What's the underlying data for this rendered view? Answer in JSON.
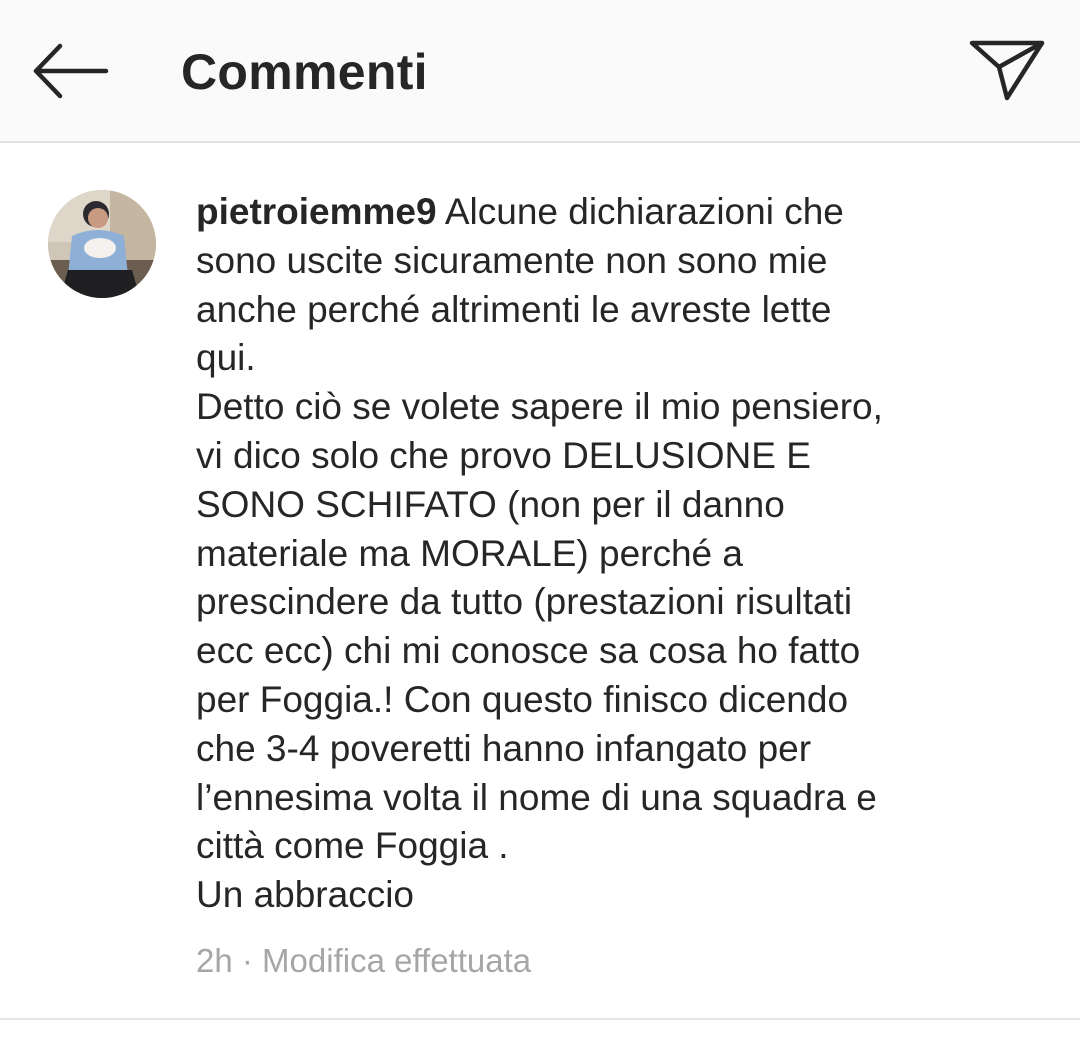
{
  "header": {
    "title": "Commenti",
    "back_icon": "arrow-left-icon",
    "share_icon": "paper-plane-icon"
  },
  "comment": {
    "username": "pietroiemme9",
    "text": "Alcune dichiarazioni che\nsono uscite sicuramente non sono mie\nanche perché altrimenti le avreste lette\nqui.\nDetto ciò se volete sapere il mio pensiero,\nvi dico solo che provo DELUSIONE E\nSONO SCHIFATO (non per il danno\nmateriale ma MORALE) perché a\nprescindere da tutto (prestazioni risultati\necc ecc) chi mi conosce sa cosa ho fatto\nper Foggia.! Con questo finisco dicendo\nche 3-4 poveretti hanno infangato per\nl’ennesima volta il nome di una squadra e\ncittà come Foggia .\nUn abbraccio",
    "time": "2h",
    "separator": " · ",
    "edited_label": "Modifica effettuata"
  },
  "colors": {
    "header_bg": "#fafafa",
    "text": "#262626",
    "meta_text": "#a6a6a6",
    "divider": "#e2e2e2"
  }
}
